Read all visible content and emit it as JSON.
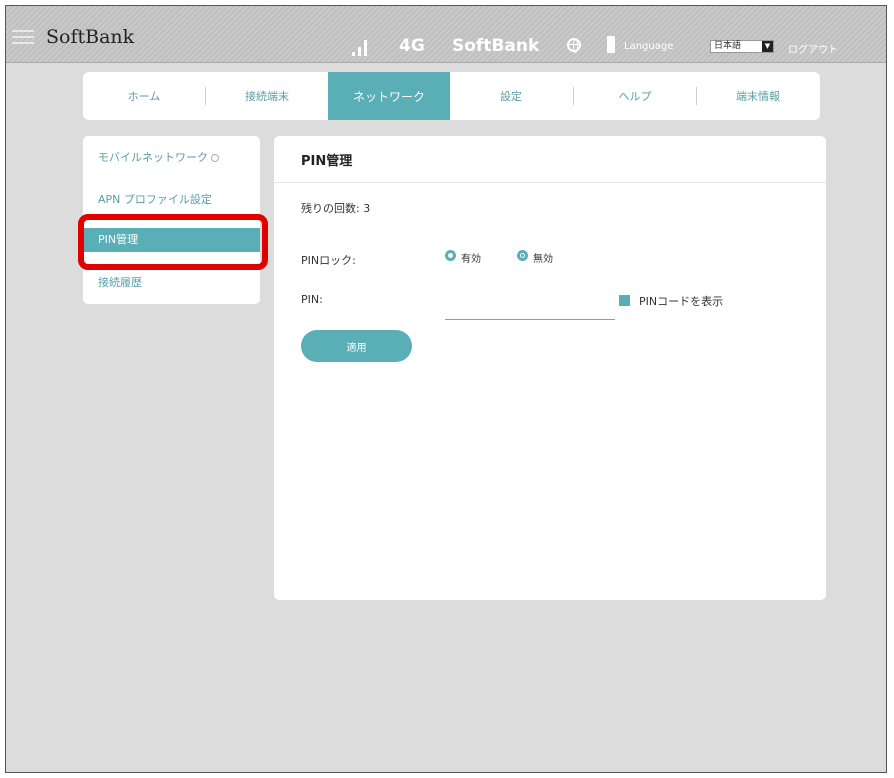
{
  "header": {
    "brand": "SoftBank",
    "network_type": "4G",
    "carrier": "SoftBank",
    "language_label": "Language",
    "language_value": "日本語",
    "logout_label": "ログアウト"
  },
  "nav": {
    "tabs": [
      {
        "label": "ホーム",
        "active": false
      },
      {
        "label": "接続端末",
        "active": false
      },
      {
        "label": "ネットワーク",
        "active": true
      },
      {
        "label": "設定",
        "active": false
      },
      {
        "label": "ヘルプ",
        "active": false
      },
      {
        "label": "端末情報",
        "active": false
      }
    ]
  },
  "sidebar": {
    "items": [
      {
        "label": "モバイルネットワーク",
        "active": false
      },
      {
        "label": "APN プロファイル設定",
        "active": false
      },
      {
        "label": "PIN管理",
        "active": true
      },
      {
        "label": "接続履歴",
        "active": false
      }
    ]
  },
  "panel": {
    "title": "PIN管理",
    "remaining_label": "残りの回数:",
    "remaining_value": "3",
    "pin_lock_label": "PINロック:",
    "pin_lock_options": [
      "有効",
      "無効"
    ],
    "pin_lock_selected": "無効",
    "pin_label": "PIN:",
    "pin_value": "",
    "show_pin_label": "PINコードを表示",
    "apply_button": "適用"
  },
  "colors": {
    "accent": "#5aaeb5",
    "highlight": "#e00000",
    "background": "#dcdcdc"
  }
}
